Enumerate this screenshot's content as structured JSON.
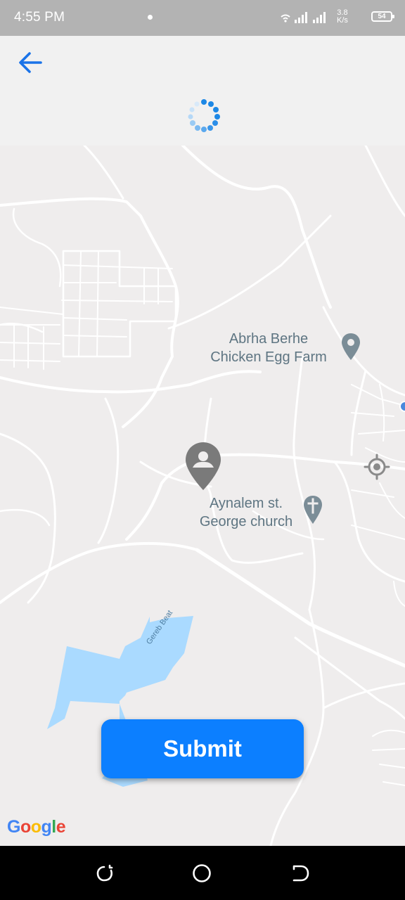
{
  "status_bar": {
    "time": "4:55 PM",
    "speed_value": "3.8",
    "speed_unit": "K/s",
    "battery": "54"
  },
  "header": {
    "back_icon": "arrow-left-icon",
    "loading_icon": "loading-spinner-icon",
    "accent_color": "#1a73e8"
  },
  "map": {
    "pois": [
      {
        "line1": "Abrha Berhe",
        "line2": "Chicken Egg Farm",
        "icon": "location-pin-icon"
      },
      {
        "line1": "Aynalem st.",
        "line2": "George church",
        "icon": "church-cross-icon"
      }
    ],
    "stream_label": "Gereb Beat",
    "attribution": "Google",
    "user_pin_icon": "user-location-pin-icon",
    "locate_icon": "crosshair-icon",
    "water_color": "#aadaff"
  },
  "submit": {
    "label": "Submit",
    "color": "#0c7fff"
  },
  "nav_bar": {
    "recent_icon": "recent-apps-icon",
    "home_icon": "home-circle-icon",
    "back_icon": "back-nav-icon"
  }
}
